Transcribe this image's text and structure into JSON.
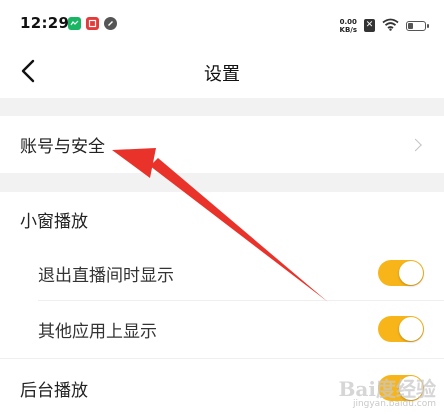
{
  "status_bar": {
    "time": "12:29",
    "net_speed_value": "0.00",
    "net_speed_unit": "KB/s",
    "battery_level": 0.3,
    "icons": [
      "app-icon-green",
      "app-icon-red",
      "app-icon-round",
      "sim-off-icon",
      "wifi-icon",
      "battery-icon"
    ]
  },
  "nav": {
    "title": "设置",
    "back_icon": "chevron-left-icon"
  },
  "settings": {
    "account": {
      "label": "账号与安全"
    },
    "small_window": {
      "label": "小窗播放",
      "options": [
        {
          "label": "退出直播间时显示",
          "enabled": true
        },
        {
          "label": "其他应用上显示",
          "enabled": true
        }
      ]
    },
    "background_play": {
      "label": "后台播放",
      "enabled": true
    }
  },
  "colors": {
    "toggle_on": "#f8b519",
    "arrow": "#e8322a",
    "section_gap": "#f2f2f2"
  },
  "watermark": {
    "brand": "Bai度经验",
    "url": "jingyan.baidu.com"
  }
}
